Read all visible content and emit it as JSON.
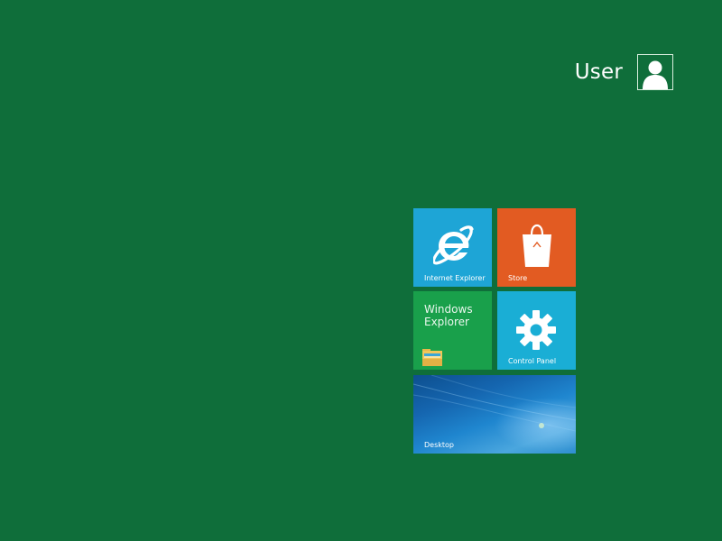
{
  "user": {
    "name": "User",
    "avatar_icon": "user-silhouette-icon"
  },
  "tiles": {
    "internet_explorer": {
      "label": "Internet Explorer",
      "icon": "internet-explorer-icon",
      "color": "#1ea5d6"
    },
    "store": {
      "label": "Store",
      "icon": "shopping-bag-icon",
      "color": "#e25b22"
    },
    "windows_explorer": {
      "title": "Windows Explorer",
      "icon": "folder-icon",
      "color": "#19a04b"
    },
    "control_panel": {
      "label": "Control Panel",
      "icon": "gear-icon",
      "color": "#1aaed5"
    },
    "desktop": {
      "label": "Desktop",
      "icon": "desktop-wallpaper"
    }
  },
  "colors": {
    "background": "#0f6e3a"
  }
}
